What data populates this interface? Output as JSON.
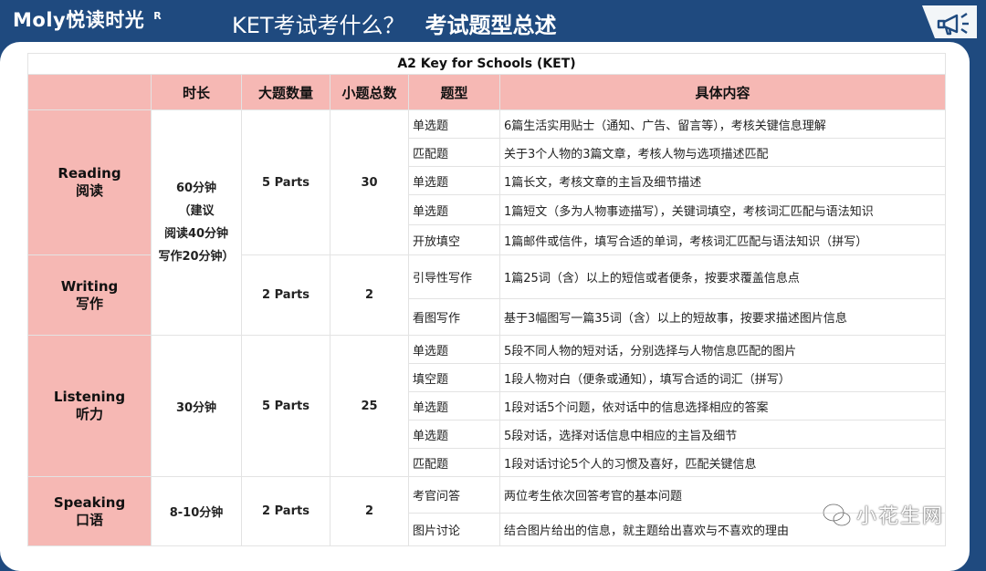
{
  "brand": {
    "name": "Moly悦读时光",
    "mark": "R"
  },
  "header": {
    "question": "KET考试考什么？",
    "subtitle": "考试题型总述"
  },
  "table": {
    "title": "A2 Key for Schools (KET)",
    "headers": {
      "duration": "时长",
      "parts": "大题数量",
      "count": "小题总数",
      "type": "题型",
      "content": "具体内容"
    },
    "reading": {
      "name": "Reading",
      "name_cn": "阅读",
      "duration": [
        "60分钟",
        "（建议",
        "阅读40分钟",
        "写作20分钟）"
      ],
      "parts": "5 Parts",
      "count": "30",
      "rows": [
        {
          "type": "单选题",
          "content": "6篇生活实用贴士（通知、广告、留言等），考核关键信息理解"
        },
        {
          "type": "匹配题",
          "content": "关于3个人物的3篇文章，考核人物与选项描述匹配"
        },
        {
          "type": "单选题",
          "content": "1篇长文，考核文章的主旨及细节描述"
        },
        {
          "type": "单选题",
          "content": "1篇短文（多为人物事迹描写），关键词填空，考核词汇匹配与语法知识"
        },
        {
          "type": "开放填空",
          "content": "1篇邮件或信件，填写合适的单词，考核词汇匹配与语法知识（拼写）"
        }
      ]
    },
    "writing": {
      "name": "Writing",
      "name_cn": "写作",
      "parts": "2 Parts",
      "count": "2",
      "rows": [
        {
          "type": "引导性写作",
          "content": "1篇25词（含）以上的短信或者便条，按要求覆盖信息点"
        },
        {
          "type": "看图写作",
          "content": "基于3幅图写一篇35词（含）以上的短故事，按要求描述图片信息"
        }
      ]
    },
    "listening": {
      "name": "Listening",
      "name_cn": "听力",
      "duration": "30分钟",
      "parts": "5 Parts",
      "count": "25",
      "rows": [
        {
          "type": "单选题",
          "content": "5段不同人物的短对话，分别选择与人物信息匹配的图片"
        },
        {
          "type": "填空题",
          "content": "1段人物对白（便条或通知），填写合适的词汇（拼写）"
        },
        {
          "type": "单选题",
          "content": "1段对话5个问题，依对话中的信息选择相应的答案"
        },
        {
          "type": "单选题",
          "content": "5段对话，选择对话信息中相应的主旨及细节"
        },
        {
          "type": "匹配题",
          "content": "1段对话讨论5个人的习惯及喜好，匹配关键信息"
        }
      ]
    },
    "speaking": {
      "name": "Speaking",
      "name_cn": "口语",
      "duration": "8-10分钟",
      "parts": "2 Parts",
      "count": "2",
      "rows": [
        {
          "type": "考官问答",
          "content": "两位考生依次回答考官的基本问题"
        },
        {
          "type": "图片讨论",
          "content": "结合图片给出的信息，就主题给出喜欢与不喜欢的理由"
        }
      ]
    }
  },
  "watermark": "小花生网",
  "colors": {
    "header_bg": "#1f4a7f",
    "pink": "#f6b8b4"
  }
}
